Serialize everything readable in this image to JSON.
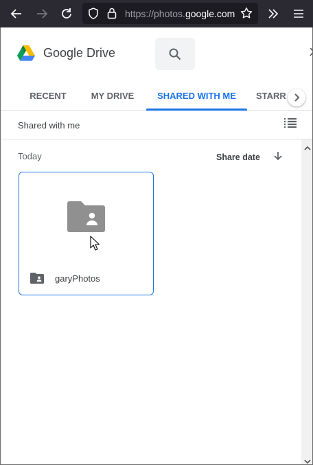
{
  "browser": {
    "url_prefix": "https://photos.",
    "url_domain": "google.com",
    "icons": [
      "back-arrow-icon",
      "forward-arrow-icon",
      "reload-icon",
      "shield-icon",
      "lock-icon",
      "star-icon",
      "overflow-chevrons-icon",
      "hamburger-menu-icon"
    ]
  },
  "header": {
    "app_title": "Google Drive",
    "close_label": "X"
  },
  "tabs": [
    {
      "label": "RECENT",
      "active": false
    },
    {
      "label": "MY DRIVE",
      "active": false
    },
    {
      "label": "SHARED WITH ME",
      "active": true
    },
    {
      "label": "STARR",
      "active": false
    }
  ],
  "subheader": {
    "title": "Shared with me"
  },
  "content": {
    "section_label": "Today",
    "sort_label": "Share date",
    "items": [
      {
        "name": "garyPhotos",
        "type": "shared-folder"
      }
    ]
  },
  "colors": {
    "accent": "#1a73e8",
    "browser_toolbar": "#2b2a33",
    "folder_grey": "#909090"
  }
}
